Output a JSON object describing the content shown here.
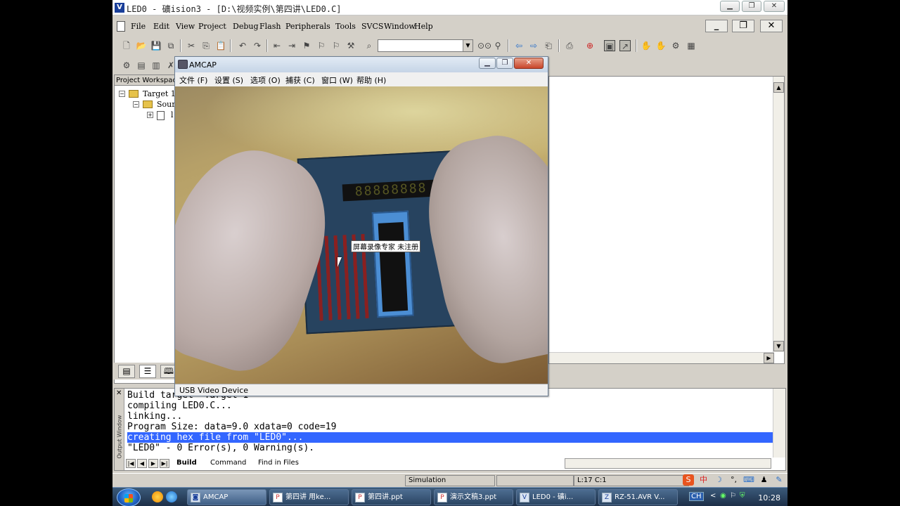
{
  "window": {
    "title": "LED0  - 礦ision3 - [D:\\视频实例\\第四讲\\LED0.C]"
  },
  "menu": [
    "File",
    "Edit",
    "View",
    "Project",
    "Debug",
    "Flash",
    "Peripherals",
    "Tools",
    "SVCS",
    "Window",
    "Help"
  ],
  "mdi": {
    "minimize": "_",
    "restore": "❐",
    "close": "✕"
  },
  "workspace": {
    "title": "Project Workspace",
    "tree": [
      "Target 1",
      "Sour",
      "l"
    ]
  },
  "output": {
    "lines": [
      "Build target 'Target 1'",
      "compiling LED0.C...",
      "linking...",
      "Program Size: data=9.0 xdata=0 code=19",
      "creating hex file from \"LED0\"...",
      "\"LED0\" - 0 Error(s), 0 Warning(s)."
    ],
    "highlighted_index": 4,
    "side_label": "Output Window",
    "tabs": [
      "Build",
      "Command",
      "Find in Files"
    ]
  },
  "status": {
    "mode": "Simulation",
    "position": "L:17 C:1"
  },
  "ime": {
    "items": [
      "S",
      "中",
      "☽",
      "°,",
      "⌨",
      "♟",
      "✎"
    ]
  },
  "taskbar": {
    "tasks": [
      {
        "label": "AMCAP",
        "active": true
      },
      {
        "label": "第四讲 用ke...",
        "active": false
      },
      {
        "label": "第四讲.ppt",
        "active": false
      },
      {
        "label": "演示文稿3.ppt",
        "active": false
      },
      {
        "label": "LED0  - 礦i...",
        "active": false
      },
      {
        "label": "RZ-51.AVR V...",
        "active": false
      }
    ],
    "lang": "CH",
    "clock": "10:28"
  },
  "amcap": {
    "title": "AMCAP",
    "menu": [
      "文件 (F)",
      "设置 (S)",
      "选项 (O)",
      "捕获 (C)",
      "窗口 (W)",
      "帮助 (H)"
    ],
    "overlay_text": "屏幕录像专家 未注册",
    "status": "USB Video Device",
    "segment_display": "88888888"
  }
}
